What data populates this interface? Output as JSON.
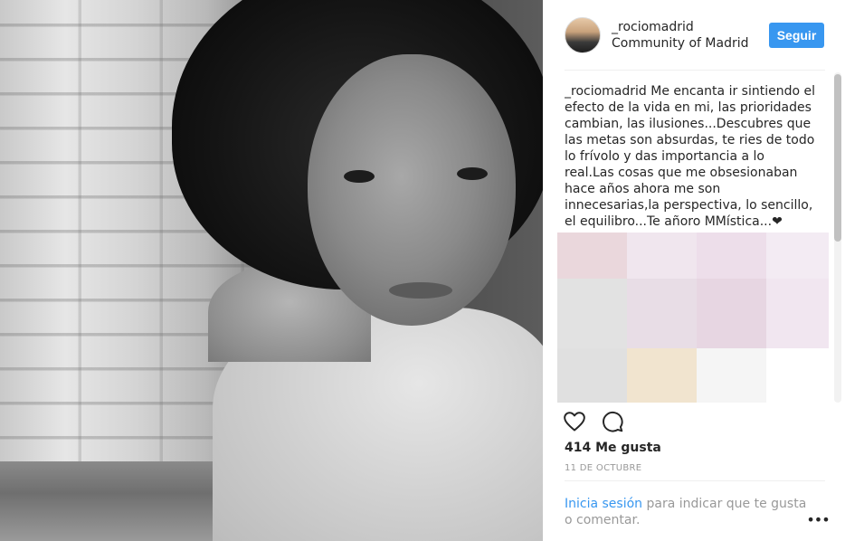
{
  "post": {
    "photo_alt": "",
    "author": {
      "username": "_rociomadrid",
      "location": "Community of Madrid"
    },
    "follow_label": "Seguir",
    "caption": {
      "author": "_rociomadrid",
      "text": "Me encanta ir sintiendo el efecto de la vida en mi, las prioridades cambian, las ilusiones...Descubres que las metas son absurdas, te ries de todo lo frívolo y das importancia a lo real.Las cosas que me obsesionaban hace años ahora me son innecesarias,la perspectiva, lo sencillo, el equilibro...Te añoro MMística...❤"
    },
    "likes": "414 Me gusta",
    "date": "11 DE OCTUBRE",
    "login_prompt": {
      "link": "Inicia sesión",
      "rest": " para indicar que te gusta o comentar."
    },
    "more_label": "•••"
  },
  "icons": {
    "like": "heart-icon",
    "comment": "speech-bubble-icon",
    "more": "ellipsis-icon"
  },
  "colors": {
    "follow_button": "#3897f0",
    "link": "#3897f0",
    "muted_text": "#999999",
    "text": "#262626",
    "divider": "#efefef"
  },
  "mosaic_colors": [
    "#ead7dc",
    "#f0e6ee",
    "#eddeea",
    "#f3ebf3",
    "#e2e2e2",
    "#e8dde6",
    "#e7d6e2",
    "#f1e6f0",
    "#e0e0e0",
    "#f1e4cf",
    "#f5f5f5",
    "#ffffff"
  ]
}
